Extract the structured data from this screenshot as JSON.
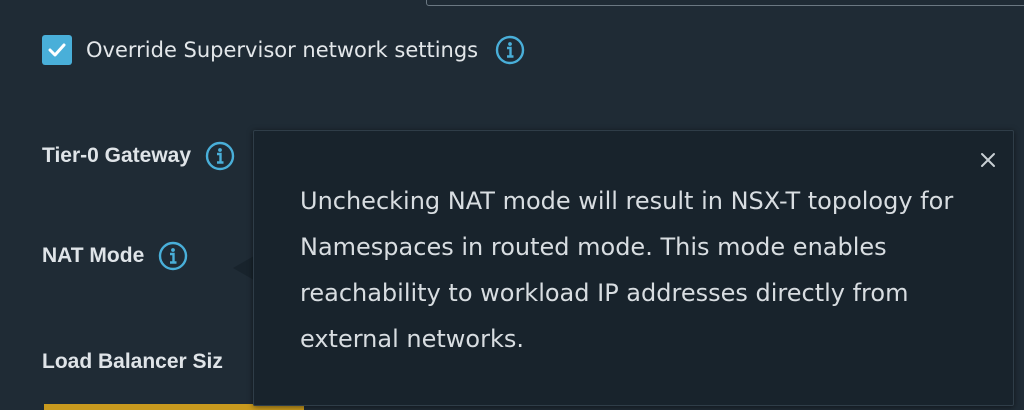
{
  "override": {
    "checked": true,
    "label": "Override Supervisor network settings",
    "info_icon": "info-icon"
  },
  "fields": {
    "tier0_gateway": "Tier-0 Gateway",
    "nat_mode": "NAT Mode",
    "load_balancer_size": "Load Balancer Siz"
  },
  "tooltip": {
    "text": "Unchecking NAT mode will result in NSX-T topology for Namespaces in routed mode. This mode enables reachability to workload IP addresses directly from external networks.",
    "close_icon": "close-icon"
  },
  "colors": {
    "background": "#1f2b35",
    "accent": "#49afd9",
    "tooltip_bg": "#18232c",
    "warning_bar": "#c99a1e"
  }
}
